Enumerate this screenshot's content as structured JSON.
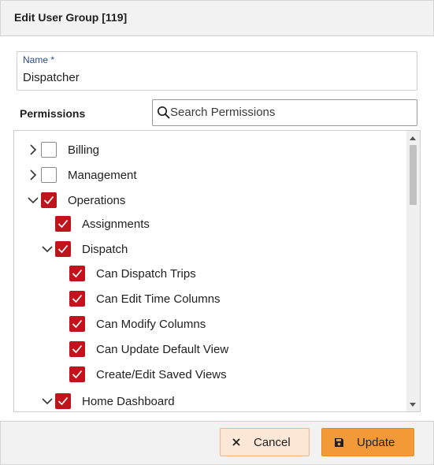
{
  "dialog": {
    "title": "Edit User Group [119]"
  },
  "name_field": {
    "label": "Name *",
    "value": "Dispatcher"
  },
  "permissions": {
    "label": "Permissions",
    "search_placeholder": "Search Permissions",
    "tree": [
      {
        "label": "Billing",
        "checked": false,
        "expandable": true,
        "expanded": false
      },
      {
        "label": "Management",
        "checked": false,
        "expandable": true,
        "expanded": false
      },
      {
        "label": "Operations",
        "checked": true,
        "expandable": true,
        "expanded": true
      },
      {
        "label": "Assignments",
        "checked": true,
        "expandable": false
      },
      {
        "label": "Dispatch",
        "checked": true,
        "expandable": true,
        "expanded": true
      },
      {
        "label": "Can Dispatch Trips",
        "checked": true,
        "expandable": false
      },
      {
        "label": "Can Edit Time Columns",
        "checked": true,
        "expandable": false
      },
      {
        "label": "Can Modify Columns",
        "checked": true,
        "expandable": false
      },
      {
        "label": "Can Update Default View",
        "checked": true,
        "expandable": false
      },
      {
        "label": "Create/Edit Saved Views",
        "checked": true,
        "expandable": false
      },
      {
        "label": "Home Dashboard",
        "checked": true,
        "expandable": true,
        "expanded": true
      }
    ]
  },
  "footer": {
    "cancel_label": "Cancel",
    "update_label": "Update"
  },
  "colors": {
    "checkbox_checked": "#c0141c",
    "update_button": "#f39a38",
    "cancel_button": "#fde7d6"
  },
  "icons": {
    "search": "search-icon",
    "cancel": "close-icon",
    "update": "save-icon"
  }
}
